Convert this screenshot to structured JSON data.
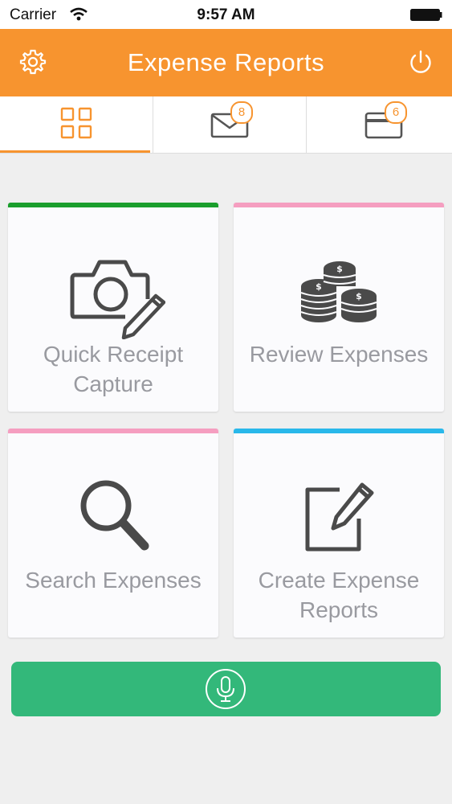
{
  "status_bar": {
    "carrier": "Carrier",
    "time": "9:57 AM"
  },
  "header": {
    "title": "Expense Reports",
    "left_icon": "gear-icon",
    "right_icon": "power-icon"
  },
  "tabs": [
    {
      "name": "dashboard",
      "icon": "grid-icon",
      "active": true
    },
    {
      "name": "messages",
      "icon": "envelope-icon",
      "badge": "8"
    },
    {
      "name": "cards",
      "icon": "credit-card-icon",
      "badge": "6"
    }
  ],
  "tiles": [
    {
      "label": "Quick Receipt\nCapture",
      "icon": "camera-pencil-icon",
      "accent": "#1a9e2c"
    },
    {
      "label": "Review Expenses",
      "icon": "coins-icon",
      "accent": "#f59ec0"
    },
    {
      "label": "Search Expenses",
      "icon": "magnifier-icon",
      "accent": "#f59ec0"
    },
    {
      "label": "Create Expense\nReports",
      "icon": "edit-icon",
      "accent": "#29b8ea"
    }
  ],
  "voice_button": {
    "icon": "microphone-icon",
    "color": "#33b87a"
  },
  "colors": {
    "brand": "#f7942f",
    "icon_gray": "#4a4a4a",
    "label_gray": "#999aa0"
  }
}
